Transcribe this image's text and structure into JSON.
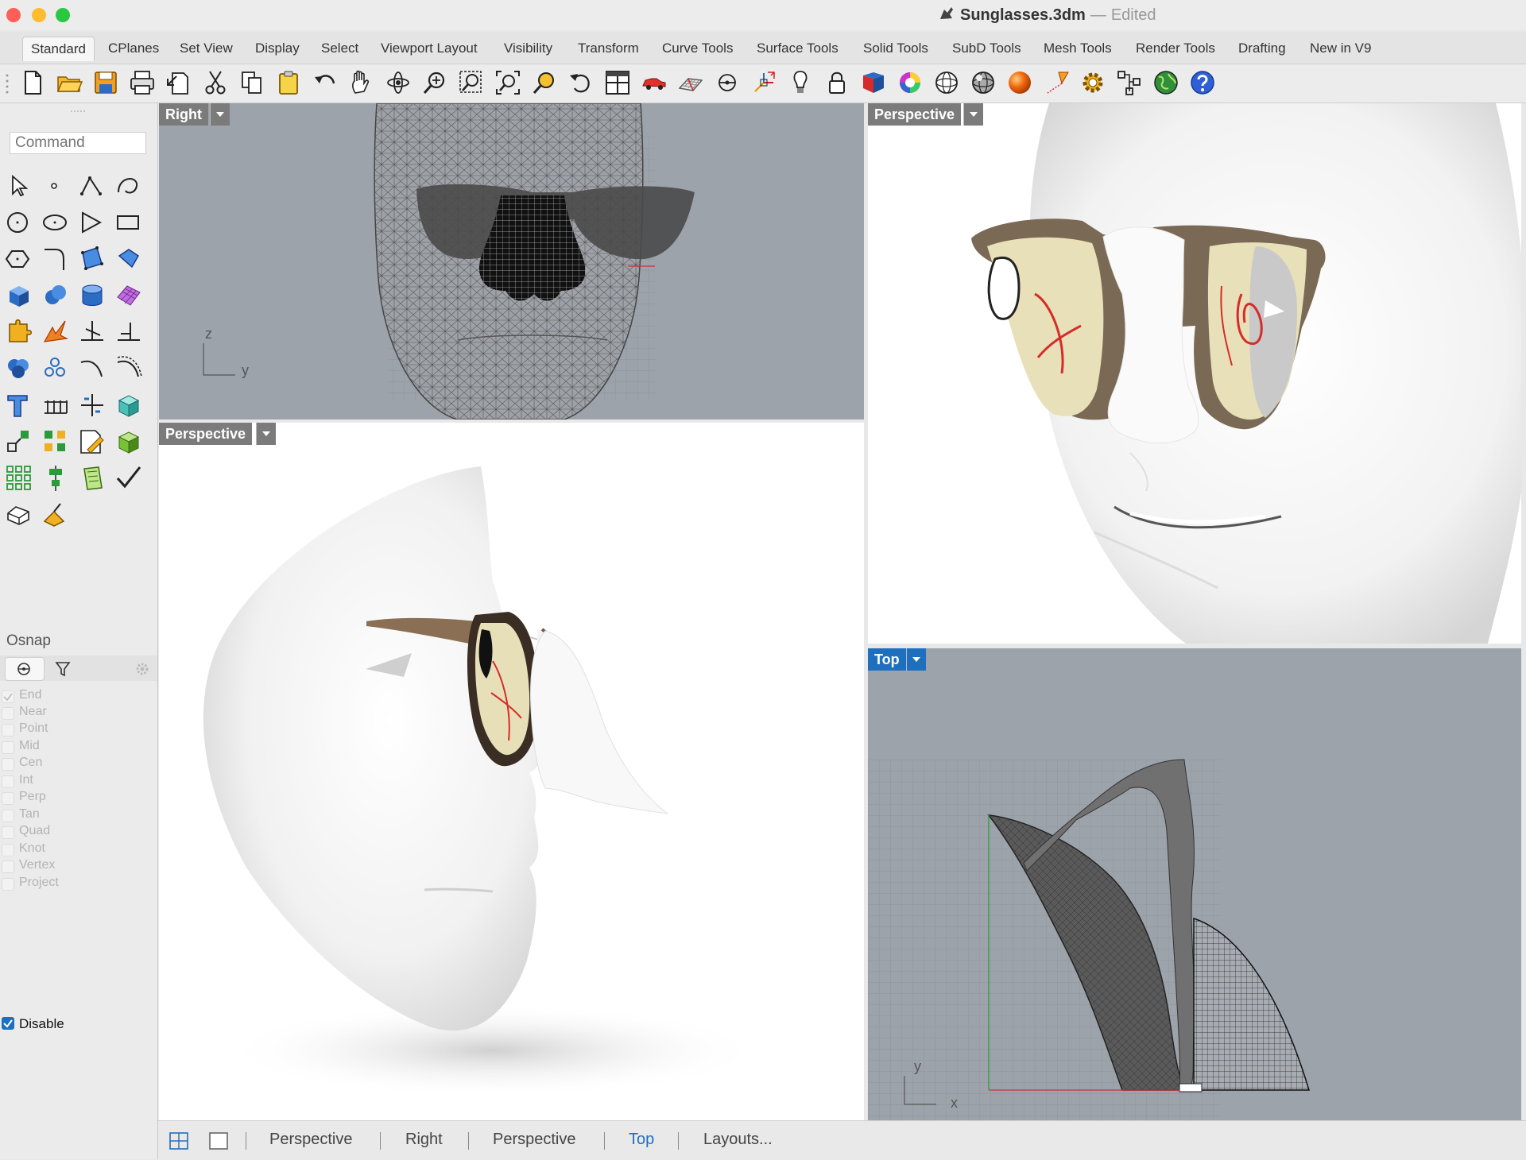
{
  "window": {
    "file_name": "Sunglasses.3dm",
    "separator": "—",
    "status": "Edited",
    "colors": {
      "close": "#fe5f57",
      "minimize": "#febc2e",
      "zoom": "#28c840",
      "accent": "#1f6fbf"
    }
  },
  "tabs": [
    {
      "label": "Standard",
      "active": true
    },
    {
      "label": "CPlanes"
    },
    {
      "label": "Set View"
    },
    {
      "label": "Display"
    },
    {
      "label": "Select"
    },
    {
      "label": "Viewport Layout"
    },
    {
      "label": "Visibility"
    },
    {
      "label": "Transform"
    },
    {
      "label": "Curve Tools"
    },
    {
      "label": "Surface Tools"
    },
    {
      "label": "Solid Tools"
    },
    {
      "label": "SubD Tools"
    },
    {
      "label": "Mesh Tools"
    },
    {
      "label": "Render Tools"
    },
    {
      "label": "Drafting"
    },
    {
      "label": "New in V9"
    }
  ],
  "toolbar_icons": [
    "new-file-icon",
    "open-folder-icon",
    "save-icon",
    "print-icon",
    "import-icon",
    "cut-icon",
    "copy-icon",
    "paste-icon",
    "undo-icon",
    "pan-hand-icon",
    "rotate-view-icon",
    "zoom-icon",
    "zoom-window-icon",
    "zoom-extents-icon",
    "zoom-selected-icon",
    "undo-view-icon",
    "four-viewports-icon",
    "car-render-icon",
    "grid-plane-icon",
    "osnap-icon",
    "gumball-icon",
    "light-icon",
    "lock-icon",
    "layer-icon",
    "color-wheel-icon",
    "wireframe-sphere-icon",
    "shaded-sphere-icon",
    "rendered-sphere-icon",
    "spotlight-icon",
    "gear-settings-icon",
    "properties-icon",
    "globe-icon",
    "help-icon"
  ],
  "sidebar": {
    "command_placeholder": "Command",
    "tools": [
      "select-arrow-icon",
      "point-icon",
      "polyline-icon",
      "curve-icon",
      "circle-icon",
      "ellipse-icon",
      "polygon-icon",
      "rectangle-icon",
      "hexagon-icon",
      "fillet-icon",
      "surface-icon",
      "patch-icon",
      "box-icon",
      "sphere-icon",
      "cylinder-icon",
      "mesh-plane-icon",
      "puzzle-icon",
      "explode-icon",
      "split-icon",
      "trim-icon",
      "boolean-icon",
      "circles-icon",
      "arc-icon",
      "offset-icon",
      "text-icon",
      "dimension-icon",
      "transform-icon",
      "cube-icon",
      "scale-icon",
      "group-icon",
      "layer-edit-icon",
      "block-icon",
      "array-icon",
      "align-icon",
      "note-icon",
      "check-icon",
      "solid-icon",
      "paint-icon"
    ],
    "osnap_title": "Osnap",
    "osnap_items": [
      "End",
      "Near",
      "Point",
      "Mid",
      "Cen",
      "Int",
      "Perp",
      "Tan",
      "Quad",
      "Knot",
      "Vertex",
      "Project"
    ],
    "disable_label": "Disable"
  },
  "viewports": {
    "right": {
      "label": "Right",
      "axis_z": "z",
      "axis_y": "y"
    },
    "persp_big": {
      "label": "Perspective"
    },
    "persp_small": {
      "label": "Perspective"
    },
    "top": {
      "label": "Top",
      "axis_y": "y",
      "axis_x": "x"
    }
  },
  "bottom_tabs": [
    {
      "label": "Perspective"
    },
    {
      "label": "Right"
    },
    {
      "label": "Perspective"
    },
    {
      "label": "Top",
      "active": true
    },
    {
      "label": "Layouts..."
    }
  ]
}
